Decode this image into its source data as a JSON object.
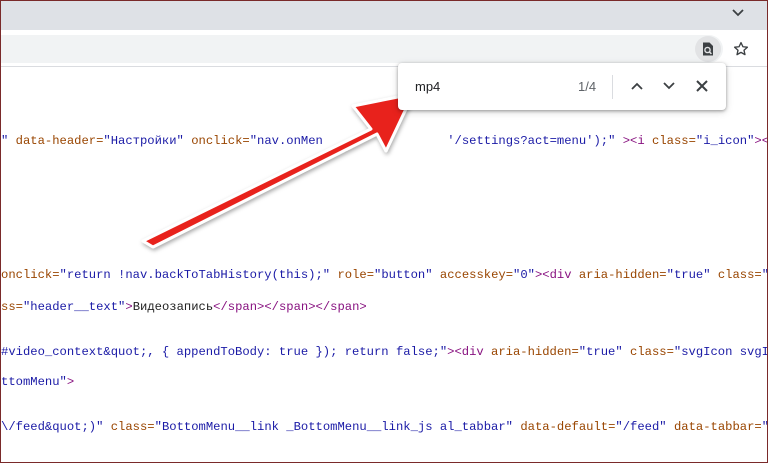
{
  "browser": {
    "colors": {
      "titlebar": "#dee1e6",
      "omnibox": "#f1f3f4",
      "arrow": "#e8231e"
    }
  },
  "find_bar": {
    "query": "mp4",
    "count": "1/4"
  },
  "source_lines": [
    [
      {
        "t": "\" ",
        "c": "v"
      },
      {
        "t": "data-header=",
        "c": "a"
      },
      {
        "t": "\"Настройки\"",
        "c": "v"
      },
      {
        "t": " ",
        "c": ""
      },
      {
        "t": "onclick=",
        "c": "a"
      },
      {
        "t": "\"nav.onMen",
        "c": "v"
      },
      {
        "t": "                 ",
        "c": ""
      },
      {
        "t": "'/settings?act=menu');\"",
        "c": "v"
      },
      {
        "t": " >",
        "c": "t"
      },
      {
        "t": "<i ",
        "c": "t"
      },
      {
        "t": "class=",
        "c": "a"
      },
      {
        "t": "\"i_icon\"",
        "c": "v"
      },
      {
        "t": "><div></div>",
        "c": "t"
      }
    ],
    [
      {
        "t": "onclick=",
        "c": "a"
      },
      {
        "t": "\"return !nav.backToTabHistory(this);\"",
        "c": "v"
      },
      {
        "t": " ",
        "c": ""
      },
      {
        "t": "role=",
        "c": "a"
      },
      {
        "t": "\"button\"",
        "c": "v"
      },
      {
        "t": " ",
        "c": ""
      },
      {
        "t": "accesskey=",
        "c": "a"
      },
      {
        "t": "\"0\"",
        "c": "v"
      },
      {
        "t": "><div ",
        "c": "t"
      },
      {
        "t": "aria-hidden=",
        "c": "a"
      },
      {
        "t": "\"true\"",
        "c": "v"
      },
      {
        "t": " ",
        "c": ""
      },
      {
        "t": "class=",
        "c": "a"
      },
      {
        "t": "\"svgIcon",
        "c": "v"
      }
    ],
    [
      {
        "t": "ss=",
        "c": "a"
      },
      {
        "t": "\"header__text\"",
        "c": "v"
      },
      {
        "t": ">",
        "c": "t"
      },
      {
        "t": "Видеозапись",
        "c": ""
      },
      {
        "t": "</span></span></span>",
        "c": "t"
      }
    ],
    [
      {
        "t": "#video_context&quot;, { appendToBody: true }); return false;\"",
        "c": "v"
      },
      {
        "t": "><div ",
        "c": "t"
      },
      {
        "t": "aria-hidden=",
        "c": "a"
      },
      {
        "t": "\"true\"",
        "c": "v"
      },
      {
        "t": " ",
        "c": ""
      },
      {
        "t": "class=",
        "c": "a"
      },
      {
        "t": "\"svgIcon svgIcon",
        "c": "v"
      }
    ],
    [
      {
        "t": "ttomMenu\"",
        "c": "v"
      },
      {
        "t": ">",
        "c": "t"
      }
    ],
    [
      {
        "t": "\\/feed&quot;)\"",
        "c": "v"
      },
      {
        "t": " ",
        "c": ""
      },
      {
        "t": "class=",
        "c": "a"
      },
      {
        "t": "\"BottomMenu__link _BottomMenu__link_js al_tabbar\"",
        "c": "v"
      },
      {
        "t": " ",
        "c": ""
      },
      {
        "t": "data-default=",
        "c": "a"
      },
      {
        "t": "\"/feed\"",
        "c": "v"
      },
      {
        "t": " ",
        "c": ""
      },
      {
        "t": "data-tabbar=",
        "c": "a"
      },
      {
        "t": "\"fee",
        "c": "v"
      }
    ]
  ]
}
